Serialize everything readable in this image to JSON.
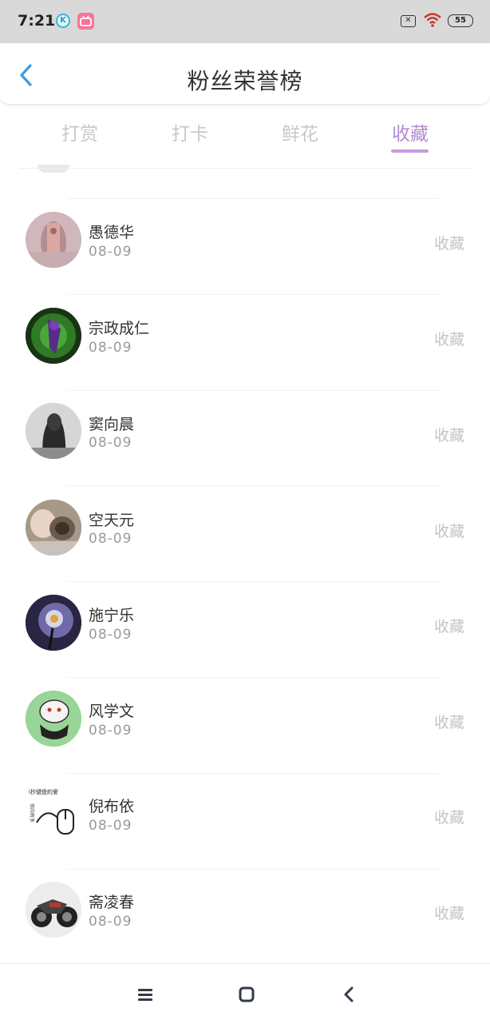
{
  "status": {
    "time": "7:21",
    "k_icon_letter": "K",
    "battery": "55"
  },
  "header": {
    "title": "粉丝荣誉榜"
  },
  "tabs": [
    {
      "label": "打赏",
      "active": false
    },
    {
      "label": "打卡",
      "active": false
    },
    {
      "label": "鲜花",
      "active": false
    },
    {
      "label": "收藏",
      "active": true
    }
  ],
  "accent_color": "#b48ccf",
  "fans": [
    {
      "name": "愚德华",
      "date": "08-09",
      "action": "收藏"
    },
    {
      "name": "宗政成仁",
      "date": "08-09",
      "action": "收藏"
    },
    {
      "name": "窦向晨",
      "date": "08-09",
      "action": "收藏"
    },
    {
      "name": "空天元",
      "date": "08-09",
      "action": "收藏"
    },
    {
      "name": "施宁乐",
      "date": "08-09",
      "action": "收藏"
    },
    {
      "name": "风学文",
      "date": "08-09",
      "action": "收藏"
    },
    {
      "name": "倪布依",
      "date": "08-09",
      "action": "收藏"
    },
    {
      "name": "斋凌春",
      "date": "08-09",
      "action": "收藏"
    }
  ],
  "avatar_text": {
    "mouse_avatar_caption": "i抄键盘的爱",
    "mouse_avatar_side": "你向有多"
  },
  "icons": [
    "back-chevron-icon",
    "menu-icon",
    "home-square-icon",
    "back-arrow-icon",
    "wifi-icon",
    "battery-icon"
  ]
}
